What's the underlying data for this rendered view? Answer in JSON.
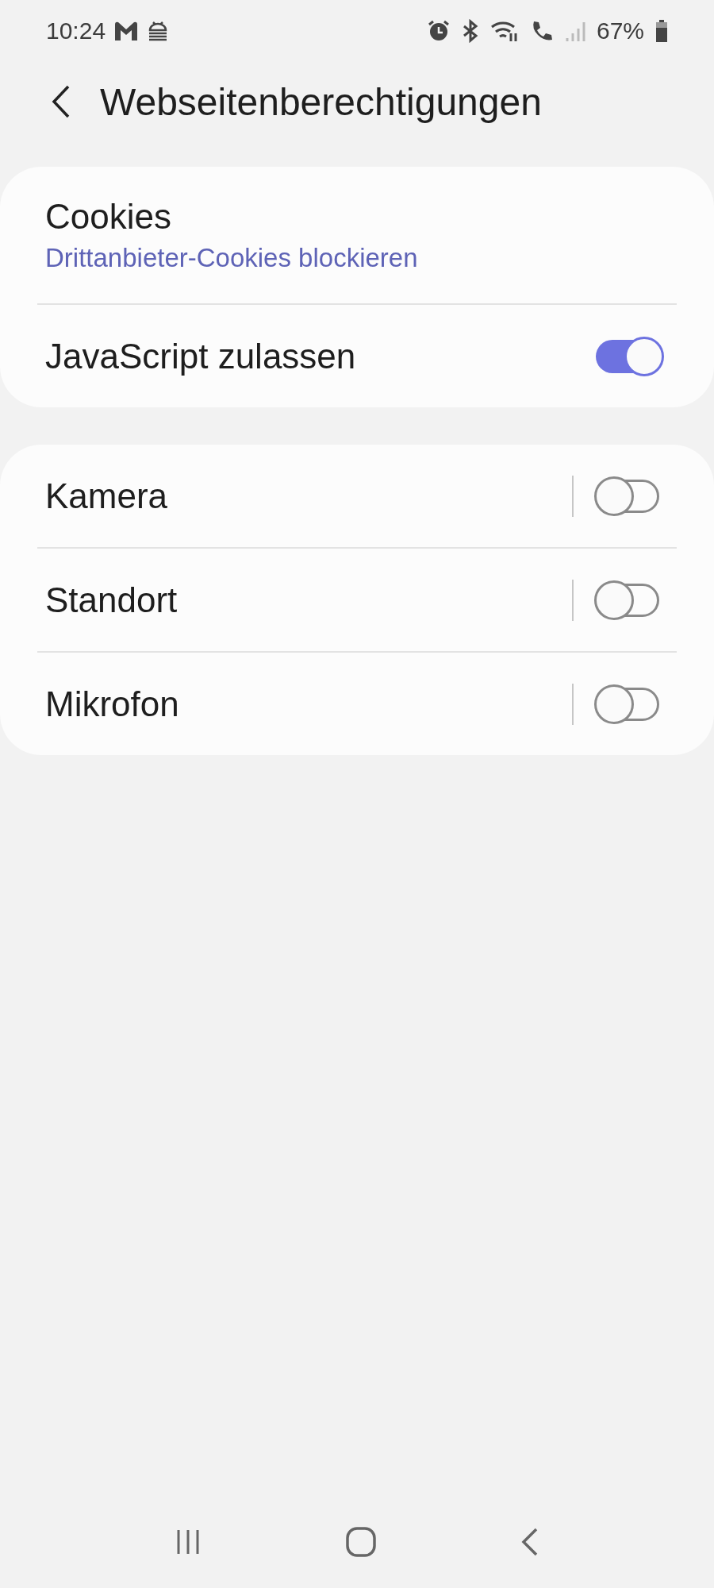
{
  "status_bar": {
    "time": "10:24",
    "battery": "67%"
  },
  "header": {
    "title": "Webseitenberechtigungen"
  },
  "sections": [
    {
      "items": [
        {
          "kind": "link",
          "title": "Cookies",
          "subtitle": "Drittanbieter-Cookies blockieren"
        },
        {
          "kind": "switch",
          "title": "JavaScript zulassen",
          "on": true,
          "separator": false
        }
      ]
    },
    {
      "items": [
        {
          "kind": "switch",
          "title": "Kamera",
          "on": false,
          "separator": true
        },
        {
          "kind": "switch",
          "title": "Standort",
          "on": false,
          "separator": true
        },
        {
          "kind": "switch",
          "title": "Mikrofon",
          "on": false,
          "separator": true
        }
      ]
    }
  ]
}
